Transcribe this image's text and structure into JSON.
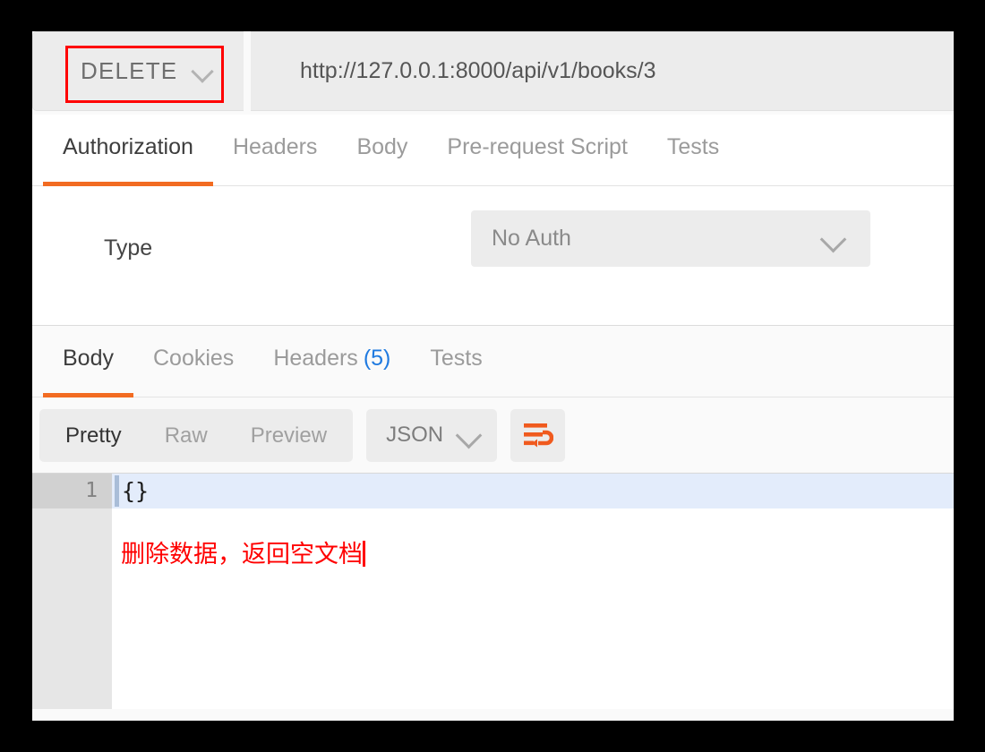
{
  "request": {
    "method": "DELETE",
    "url": "http://127.0.0.1:8000/api/v1/books/3",
    "method_highlight_color": "#ff0000",
    "tabs": [
      {
        "label": "Authorization",
        "active": true
      },
      {
        "label": "Headers",
        "active": false
      },
      {
        "label": "Body",
        "active": false
      },
      {
        "label": "Pre-request Script",
        "active": false
      },
      {
        "label": "Tests",
        "active": false
      }
    ],
    "authorization": {
      "type_label": "Type",
      "type_value": "No Auth"
    }
  },
  "response": {
    "tabs": [
      {
        "label": "Body",
        "active": true
      },
      {
        "label": "Cookies",
        "active": false
      },
      {
        "label": "Headers",
        "count": "(5)",
        "active": false
      },
      {
        "label": "Tests",
        "active": false
      }
    ],
    "view_modes": [
      {
        "label": "Pretty",
        "active": true
      },
      {
        "label": "Raw",
        "active": false
      },
      {
        "label": "Preview",
        "active": false
      }
    ],
    "format": "JSON",
    "wrap_icon": "word-wrap-icon",
    "editor": {
      "line_number": "1",
      "line_content": "{}",
      "annotation": "删除数据，返回空文档"
    }
  },
  "colors": {
    "accent": "#f26b21",
    "link": "#1f7ae0",
    "annotation": "#ff0000"
  }
}
